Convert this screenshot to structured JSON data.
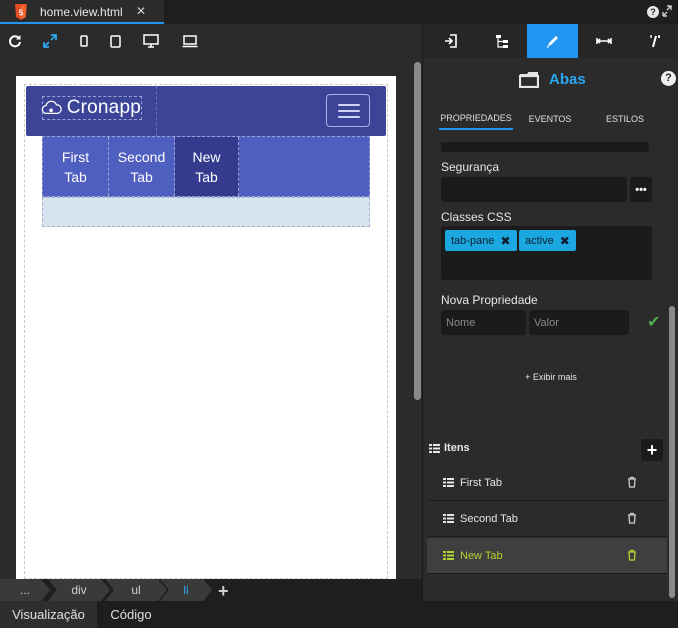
{
  "file_tab": {
    "name": "home.view.html",
    "close": "✕"
  },
  "top_right": {
    "help": "?"
  },
  "toolbar": {
    "buttons": [
      "refresh-icon",
      "fit-screen-icon",
      "phone-icon",
      "tablet-icon",
      "desktop-icon",
      "laptop-icon"
    ],
    "accent": "#2196f3"
  },
  "preview": {
    "logo_text": "Cronapp",
    "tabs": [
      {
        "label": "First\nTab",
        "active": false
      },
      {
        "label": "Second\nTab",
        "active": false
      },
      {
        "label": "New\nTab",
        "active": true
      }
    ],
    "navbar_color": "#3b4496",
    "tabs_color": "#4f5fbf",
    "active_tab_color": "#343b8e",
    "pane_color": "#d8e3f0"
  },
  "breadcrumb": {
    "items": [
      "...",
      "div",
      "ul",
      "li"
    ],
    "active_index": 3,
    "add": "+"
  },
  "bottom_tabs": [
    "Visualização",
    "Código"
  ],
  "panel": {
    "tabs": [
      "import-icon",
      "tree-icon",
      "pencil-icon",
      "resize-icon",
      "magic-icon"
    ],
    "selected_tab": 2,
    "component_name": "Abas",
    "help": "?",
    "subtabs": [
      "PROPRIEDADES",
      "EVENTOS",
      "ESTILOS"
    ],
    "selected_subtab": 0,
    "security_label": "Segurança",
    "security_value": "",
    "dots": "•••",
    "classes_label": "Classes CSS",
    "classes": [
      "tab-pane",
      "active"
    ],
    "new_prop_label": "Nova Propriedade",
    "name_placeholder": "Nome",
    "value_placeholder": "Valor",
    "show_more": "+ Exibir mais",
    "items_label": "Itens",
    "items": [
      {
        "label": "First Tab",
        "selected": false
      },
      {
        "label": "Second Tab",
        "selected": false
      },
      {
        "label": "New Tab",
        "selected": true
      }
    ],
    "add_item": "+",
    "selected_color": "#b3d334"
  }
}
